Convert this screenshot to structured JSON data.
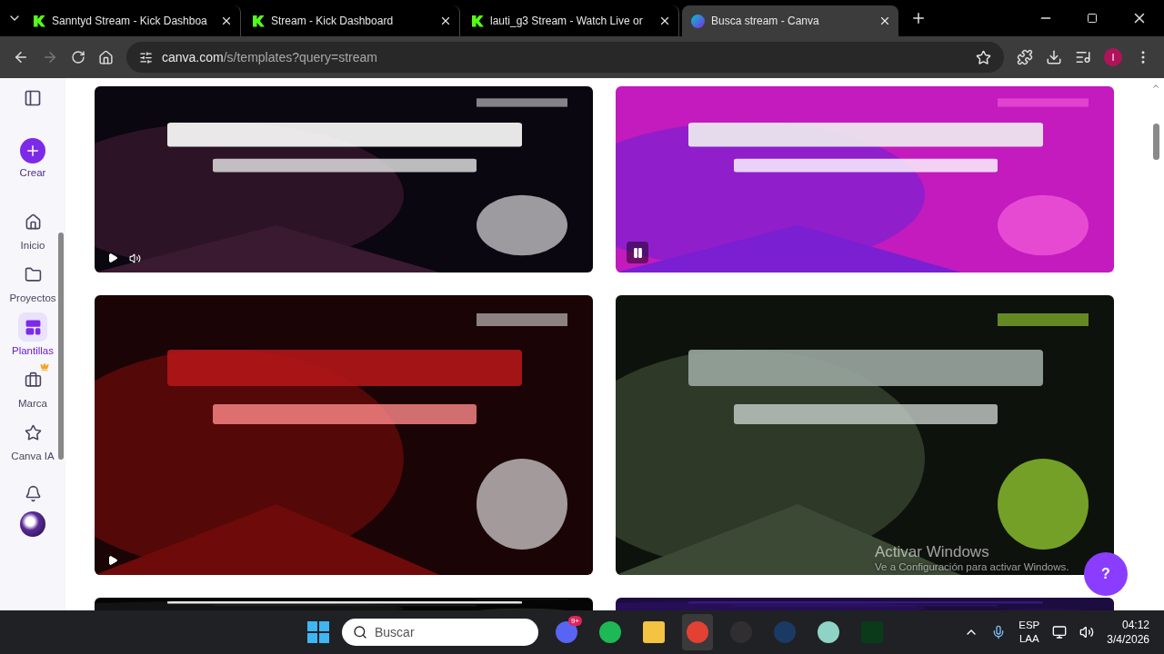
{
  "tabs": [
    {
      "title": "Sanntyd Stream - Kick Dashboa",
      "kind": "kick",
      "selected": false
    },
    {
      "title": "Stream - Kick Dashboard",
      "kind": "kick",
      "selected": false
    },
    {
      "title": "lauti_g3 Stream - Watch Live or",
      "kind": "kick",
      "selected": false
    },
    {
      "title": "Busca stream - Canva",
      "kind": "canva",
      "selected": true
    }
  ],
  "address": {
    "host": "canva.com",
    "path": "/s/templates?query=stream"
  },
  "profile": "I",
  "sidebar": {
    "create": "Crear",
    "items": [
      {
        "label": "Inicio",
        "kind": "home",
        "selected": false
      },
      {
        "label": "Proyectos",
        "kind": "folder",
        "selected": false
      },
      {
        "label": "Plantillas",
        "kind": "templates",
        "selected": true
      },
      {
        "label": "Marca",
        "kind": "brand",
        "selected": false
      },
      {
        "label": "Canva IA",
        "kind": "ai",
        "selected": false
      }
    ]
  },
  "templates": [
    {
      "kind": "picture",
      "playing": false,
      "sound": true
    },
    {
      "kind": "picture",
      "playing": true
    },
    {
      "kind": "picture",
      "playing": false
    },
    {
      "kind": "picture"
    },
    {
      "kind": "picture"
    },
    {
      "kind": "picture"
    }
  ],
  "activation": {
    "title": "Activar Windows",
    "hint": "Ve a Configuración para activar Windows."
  },
  "help": "?",
  "taskbar": {
    "search_placeholder": "Buscar",
    "apps": [
      {
        "kind": "discord",
        "badge": "9+",
        "active": false
      },
      {
        "kind": "spotify",
        "active": false
      },
      {
        "kind": "files",
        "active": false
      },
      {
        "kind": "chrome",
        "active": true
      },
      {
        "kind": "obs",
        "active": false
      },
      {
        "kind": "steam",
        "active": false
      },
      {
        "kind": "game",
        "active": false
      },
      {
        "kind": "fc",
        "active": false
      }
    ],
    "lang": "ESP",
    "region": "LAA",
    "time": "04:12",
    "date": "3/4/2026"
  }
}
